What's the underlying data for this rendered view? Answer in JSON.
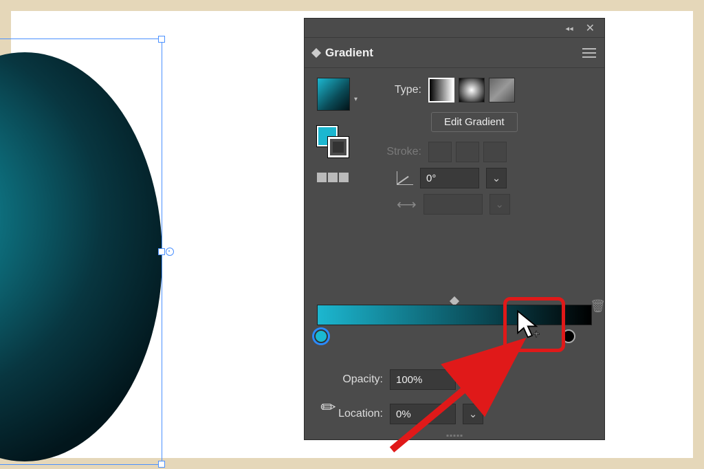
{
  "panel": {
    "title": "Gradient",
    "type_label": "Type:",
    "edit_label": "Edit Gradient",
    "stroke_label": "Stroke:",
    "angle_value": "0°",
    "opacity_label": "Opacity:",
    "opacity_value": "100%",
    "location_label": "Location:",
    "location_value": "0%"
  },
  "gradient": {
    "start_color": "#1cb7d0",
    "end_color": "#000000",
    "type": "linear"
  },
  "annotation": {
    "description": "cursor adding gradient stop"
  }
}
